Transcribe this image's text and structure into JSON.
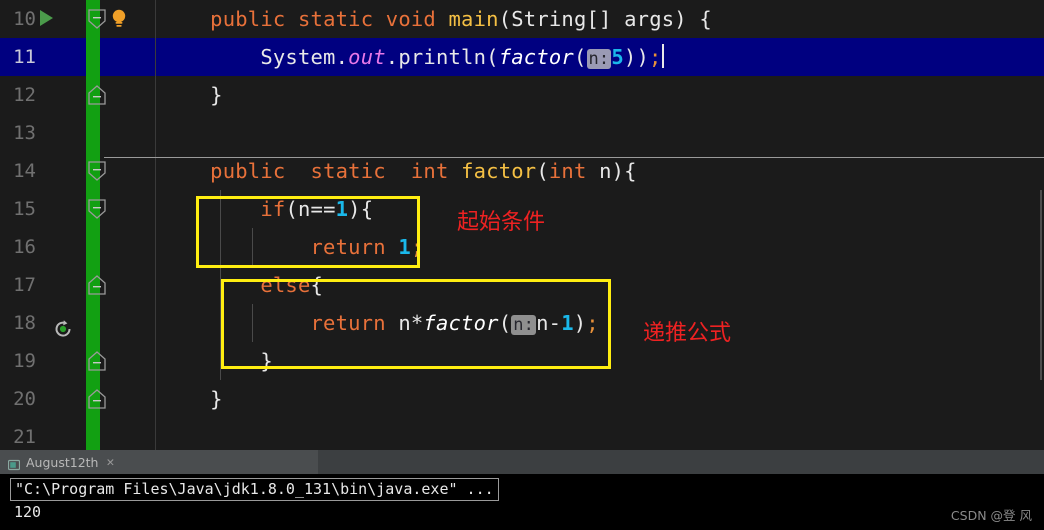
{
  "editor": {
    "background": "#1b1b1b",
    "highlight_color": "#000080",
    "accent_green": "#12a012",
    "annotation_box_color": "#ffee11",
    "annotation_text_color": "#ee2222",
    "line_numbers": [
      "10",
      "11",
      "12",
      "13",
      "14",
      "15",
      "16",
      "17",
      "18",
      "19",
      "20",
      "21"
    ],
    "lines": {
      "l10": {
        "indent": "    ",
        "public": "public",
        "sp1": " ",
        "static": "static",
        "sp2": " ",
        "void": "void",
        "sp3": " ",
        "main": "main",
        "open": "(",
        "type": "String[]",
        "sp4": " ",
        "arg": "args",
        "close": ")",
        "brace": " {"
      },
      "l11": {
        "indent": "        ",
        "system": "System",
        "dot1": ".",
        "out": "out",
        "dot2": ".",
        "println": "println",
        "open": "(",
        "factor": "factor",
        "open2": "(",
        "hint": "n:",
        "value": "5",
        "close": "))",
        "semi": ";"
      },
      "l12": {
        "indent": "    ",
        "text": "}"
      },
      "l13": {
        "text": ""
      },
      "l14": {
        "indent": "    ",
        "public": "public",
        "sp1": "  ",
        "static": "static",
        "sp2": "  ",
        "int": "int",
        "sp3": " ",
        "factor": "factor",
        "open": "(",
        "ptype": "int",
        "sp4": " ",
        "pname": "n",
        "close": ")",
        "brace": "{"
      },
      "l15": {
        "indent": "        ",
        "if": "if",
        "open": "(",
        "var": "n==",
        "num": "1",
        "close": ")",
        "brace": "{"
      },
      "l16": {
        "indent": "            ",
        "return": "return",
        "sp": " ",
        "num": "1",
        "semi": ";"
      },
      "l17": {
        "indent": "        ",
        "else": "else",
        "brace": "{"
      },
      "l18": {
        "indent": "            ",
        "return": "return",
        "sp": " ",
        "expr": "n*",
        "factor": "factor",
        "open": "(",
        "hint": "n:",
        "arg": "n-",
        "num": "1",
        "close": ")",
        "semi": ";"
      },
      "l19": {
        "indent": "        ",
        "text": "}"
      },
      "l20": {
        "indent": "    ",
        "text": "}"
      },
      "l21": {
        "text": ""
      }
    },
    "gutter_icons": {
      "run_line": "run-arrow-icon",
      "bulb_line": "intention-bulb-icon",
      "recursion_line": "recursive-call-icon"
    },
    "annotations": [
      {
        "id": "start-condition",
        "label": "起始条件"
      },
      {
        "id": "recurrence-formula",
        "label": "递推公式"
      }
    ],
    "syntax_colors": {
      "keyword": "#e8713a",
      "number": "#1ab8ea",
      "method": "#f5c044",
      "field": "#e878e8",
      "text": "#e8e8e8",
      "semicolon": "#e8913a",
      "param_hint_bg": "#9a9ab4"
    }
  },
  "bottom_panel": {
    "tab": {
      "icon": "console-window-icon",
      "label": "August12th",
      "close": "✕"
    },
    "console": {
      "command": "\"C:\\Program Files\\Java\\jdk1.8.0_131\\bin\\java.exe\" ...",
      "output": "120"
    }
  },
  "watermark": {
    "text": "CSDN @登 风"
  }
}
